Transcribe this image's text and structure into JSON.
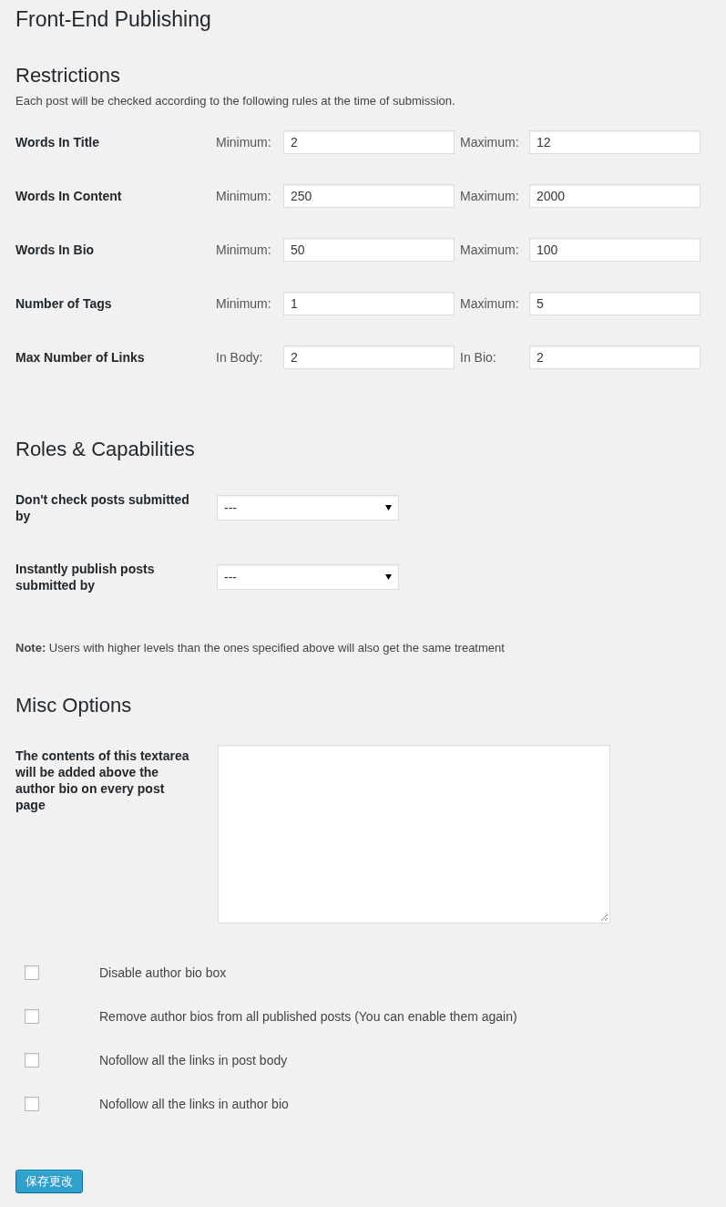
{
  "page_title": "Front-End Publishing",
  "restrictions": {
    "heading": "Restrictions",
    "description": "Each post will be checked according to the following rules at the time of submission.",
    "rows": [
      {
        "label": "Words In Title",
        "fields": [
          {
            "label": "Minimum:",
            "value": "2"
          },
          {
            "label": "Maximum:",
            "value": "12"
          }
        ]
      },
      {
        "label": "Words In Content",
        "fields": [
          {
            "label": "Minimum:",
            "value": "250"
          },
          {
            "label": "Maximum:",
            "value": "2000"
          }
        ]
      },
      {
        "label": "Words In Bio",
        "fields": [
          {
            "label": "Minimum:",
            "value": "50"
          },
          {
            "label": "Maximum:",
            "value": "100"
          }
        ]
      },
      {
        "label": "Number of Tags",
        "fields": [
          {
            "label": "Minimum:",
            "value": "1"
          },
          {
            "label": "Maximum:",
            "value": "5"
          }
        ]
      },
      {
        "label": "Max Number of Links",
        "fields": [
          {
            "label": "In Body:",
            "value": "2"
          },
          {
            "label": "In Bio:",
            "value": "2"
          }
        ]
      }
    ]
  },
  "roles": {
    "heading": "Roles & Capabilities",
    "rows": [
      {
        "label": "Don't check posts submitted by",
        "value": "---"
      },
      {
        "label": "Instantly publish posts submitted by",
        "value": "---"
      }
    ],
    "note": "**Note:** Users with higher levels than the ones specified above will also get the same treatment"
  },
  "misc": {
    "heading": "Misc Options",
    "textarea": {
      "label": "The contents of this textarea will be added above the author bio on every post page"
    },
    "options": [
      {
        "label": "Disable author bio box",
        "checked": false
      },
      {
        "label": "Remove author bios from all published posts (You can enable them again)",
        "checked": false
      },
      {
        "label": "Nofollow all the links in post body",
        "checked": false
      },
      {
        "label": "Nofollow all the links in author bio",
        "checked": false
      }
    ]
  },
  "save_button": "保存更改"
}
